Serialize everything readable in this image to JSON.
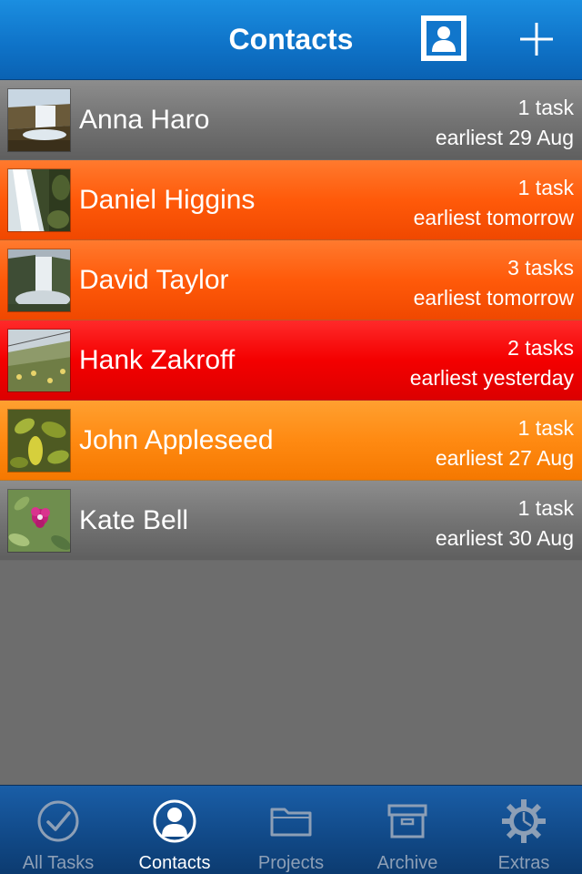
{
  "navbar": {
    "title": "Contacts",
    "contact_card_icon": "person-card-icon",
    "add_icon": "plus-icon"
  },
  "contacts": [
    {
      "name": "Anna Haro",
      "tasks": "1 task",
      "earliest": "earliest 29 Aug",
      "color": "#747474",
      "photo": "waterfall-cliff"
    },
    {
      "name": "Daniel Higgins",
      "tasks": "1 task",
      "earliest": "earliest tomorrow",
      "color": "#ff5a0a",
      "photo": "waterfall-stream"
    },
    {
      "name": "David Taylor",
      "tasks": "3 tasks",
      "earliest": "earliest tomorrow",
      "color": "#ff5a0a",
      "photo": "waterfall-mist"
    },
    {
      "name": "Hank Zakroff",
      "tasks": "2 tasks",
      "earliest": "earliest yesterday",
      "color": "#f40000",
      "photo": "hillside-flowers"
    },
    {
      "name": "John Appleseed",
      "tasks": "1 task",
      "earliest": "earliest 27 Aug",
      "color": "#ff8a12",
      "photo": "leaves"
    },
    {
      "name": "Kate Bell",
      "tasks": "1 task",
      "earliest": "earliest 30 Aug",
      "color": "#747474",
      "photo": "pink-flower"
    }
  ],
  "tabs": [
    {
      "label": "All Tasks",
      "icon": "checkmark-circle-icon",
      "active": false
    },
    {
      "label": "Contacts",
      "icon": "person-circle-icon",
      "active": true
    },
    {
      "label": "Projects",
      "icon": "folder-icon",
      "active": false
    },
    {
      "label": "Archive",
      "icon": "archive-box-icon",
      "active": false
    },
    {
      "label": "Extras",
      "icon": "gear-icon",
      "active": false
    }
  ],
  "colors": {
    "navbar": "#0f74c9",
    "tabbar": "#124c8c",
    "overdue": "#f40000",
    "due_soon": "#ff5a0a",
    "upcoming": "#ff8a12",
    "normal": "#747474"
  }
}
